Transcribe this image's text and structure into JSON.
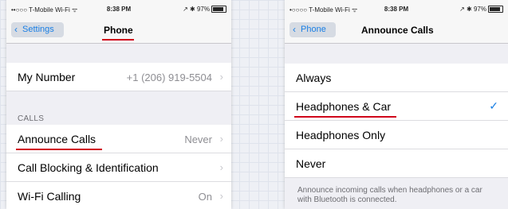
{
  "left_screen": {
    "status": {
      "carrier": "••○○○ T-Mobile Wi-Fi ᯤ",
      "time": "8:38 PM",
      "indicators": "↗ ✱ 97%"
    },
    "nav": {
      "back_label": "Settings",
      "title": "Phone"
    },
    "my_number": {
      "label": "My Number",
      "value": "+1 (206) 919-5504"
    },
    "calls_header": "CALLS",
    "rows": [
      {
        "label": "Announce Calls",
        "value": "Never"
      },
      {
        "label": "Call Blocking & Identification",
        "value": ""
      },
      {
        "label": "Wi-Fi Calling",
        "value": "On"
      }
    ]
  },
  "right_screen": {
    "status": {
      "carrier": "•○○○○ T-Mobile Wi-Fi ᯤ",
      "time": "8:38 PM",
      "indicators": "↗ ✱ 97%"
    },
    "nav": {
      "back_label": "Phone",
      "title": "Announce Calls"
    },
    "options": [
      {
        "label": "Always",
        "selected": false
      },
      {
        "label": "Headphones & Car",
        "selected": true
      },
      {
        "label": "Headphones Only",
        "selected": false
      },
      {
        "label": "Never",
        "selected": false
      }
    ],
    "checkmark": "✓",
    "footer": "Announce incoming calls when headphones or a car with Bluetooth is connected."
  },
  "colors": {
    "accent": "#1a7fe4",
    "highlight_underline": "#d0021b"
  }
}
